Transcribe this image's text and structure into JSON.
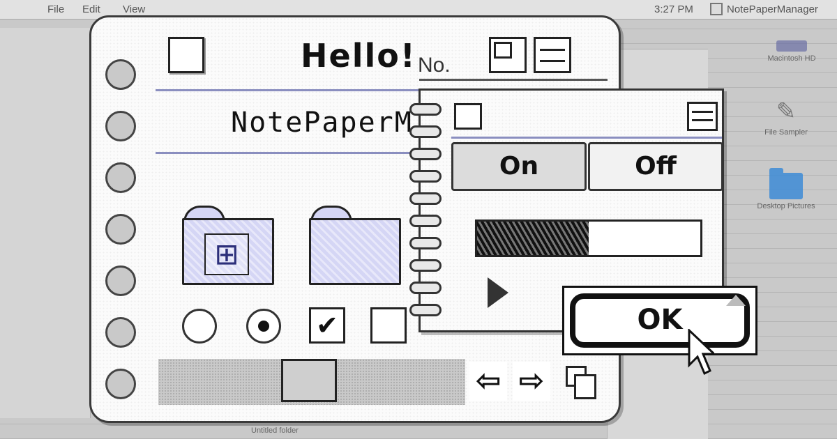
{
  "menubar": {
    "menus": [
      "File",
      "Edit",
      "View"
    ],
    "clock": "3:27 PM",
    "app_name": "NotePaperManager"
  },
  "desktop": {
    "icons": [
      {
        "label": "Macintosh HD",
        "icon": "disk-icon"
      },
      {
        "label": "File Sampler",
        "icon": "scan-icon"
      },
      {
        "label": "Desktop Pictures",
        "icon": "folder-icon"
      }
    ],
    "bottom_label": "Untitled folder"
  },
  "note_window": {
    "title": "Hello!",
    "no_label": "No.",
    "field_text": "NotePaperM",
    "radios": [
      {
        "selected": false
      },
      {
        "selected": true
      }
    ],
    "checkboxes": [
      {
        "checked": true,
        "glyph": "✔"
      },
      {
        "checked": false,
        "glyph": ""
      }
    ],
    "folder_glyph": "⊞",
    "arrows": {
      "left": "⇦",
      "right": "⇨"
    }
  },
  "palette": {
    "segment_on": "On",
    "segment_off": "Off",
    "progress": 0.5
  },
  "dialog": {
    "ok_label": "OK"
  },
  "colors": {
    "accent_rule": "#8a8ebf",
    "folder_fill": "#d5d6f5",
    "desktop": "#c9c9c9"
  }
}
